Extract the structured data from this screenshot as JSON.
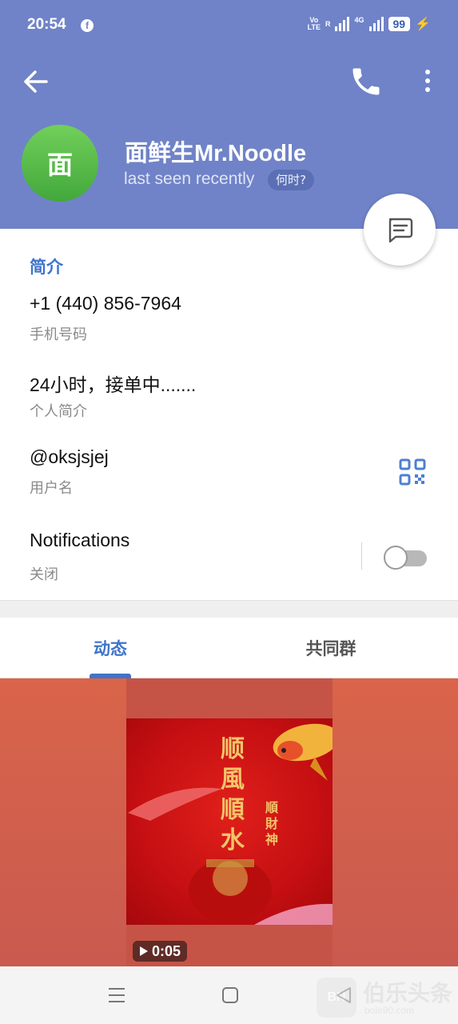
{
  "status_bar": {
    "time": "20:54",
    "network_label_top": "Vo",
    "network_label_bottom": "LTE",
    "roaming_label": "R",
    "network_type": "4G",
    "battery": "99"
  },
  "header": {
    "avatar_letter": "面",
    "name": "面鲜生Mr.Noodle",
    "status": "last seen recently",
    "when_chip": "何时?",
    "background_color": "#7083c8"
  },
  "info": {
    "section_title": "简介",
    "phone": "+1 (440) 856-7964",
    "phone_label": "手机号码",
    "bio": "24小时，接单中.......",
    "bio_label": "个人简介",
    "username": "@oksjsjej",
    "username_label": "用户名",
    "notifications": "Notifications",
    "notifications_state": "关闭",
    "notifications_enabled": false
  },
  "tabs": [
    {
      "label": "动态",
      "active": true
    },
    {
      "label": "共同群",
      "active": false
    }
  ],
  "media": {
    "duration": "0:05",
    "poster_text_1": "顺風順水",
    "poster_text_2": "順財神"
  },
  "watermark": {
    "logo": "BN",
    "title": "伯乐头条",
    "subtitle": "bole90.com"
  },
  "accent_color": "#3f74c9"
}
